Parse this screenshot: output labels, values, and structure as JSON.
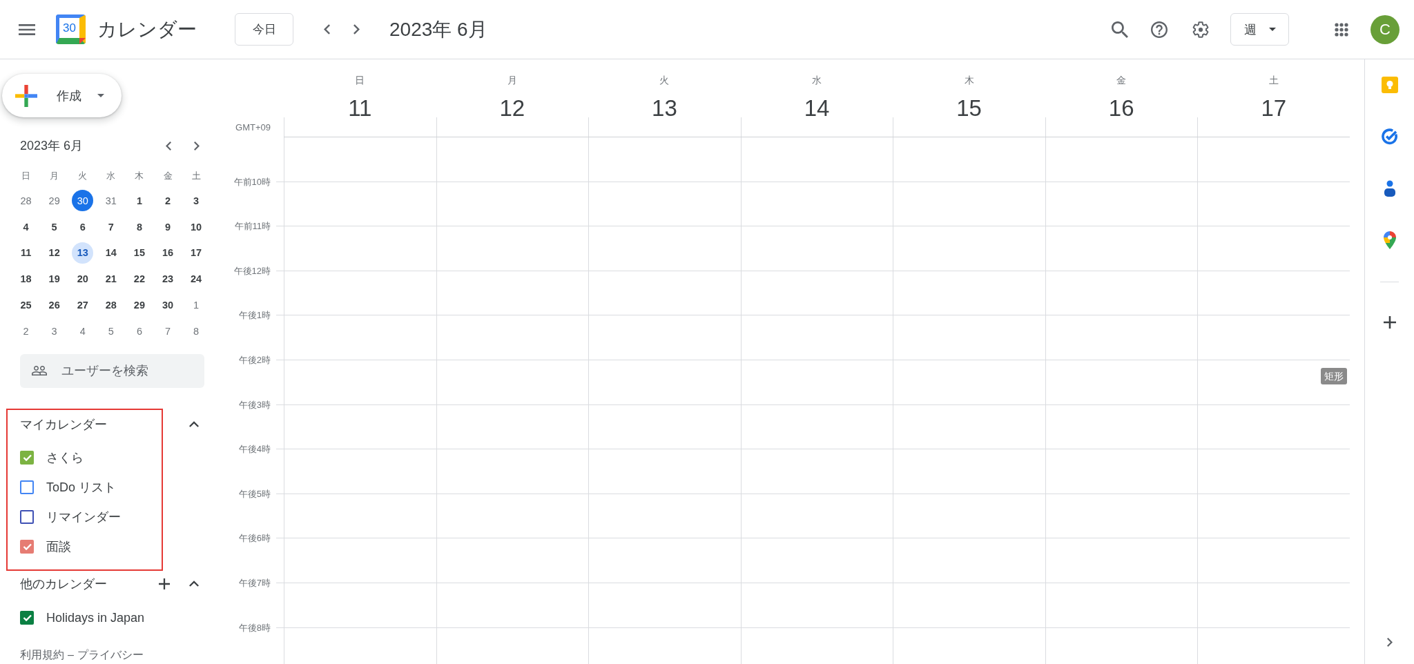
{
  "top_bar": {
    "app_name": "カレンダー",
    "logo_date": "30",
    "today_button": "今日",
    "period": "2023年 6月",
    "view_select": "週",
    "avatar_letter": "C"
  },
  "sidebar": {
    "create_button": "作成",
    "mini_calendar": {
      "title": "2023年 6月",
      "weekdays": [
        "日",
        "月",
        "火",
        "水",
        "木",
        "金",
        "土"
      ],
      "weeks": [
        [
          {
            "day": "28",
            "muted": true,
            "today": false,
            "selected": false
          },
          {
            "day": "29",
            "muted": true,
            "today": false,
            "selected": false
          },
          {
            "day": "30",
            "muted": true,
            "today": true,
            "selected": false
          },
          {
            "day": "31",
            "muted": true,
            "today": false,
            "selected": false
          },
          {
            "day": "1",
            "muted": false,
            "today": false,
            "selected": false
          },
          {
            "day": "2",
            "muted": false,
            "today": false,
            "selected": false
          },
          {
            "day": "3",
            "muted": false,
            "today": false,
            "selected": false
          }
        ],
        [
          {
            "day": "4",
            "muted": false,
            "today": false,
            "selected": false
          },
          {
            "day": "5",
            "muted": false,
            "today": false,
            "selected": false
          },
          {
            "day": "6",
            "muted": false,
            "today": false,
            "selected": false
          },
          {
            "day": "7",
            "muted": false,
            "today": false,
            "selected": false
          },
          {
            "day": "8",
            "muted": false,
            "today": false,
            "selected": false
          },
          {
            "day": "9",
            "muted": false,
            "today": false,
            "selected": false
          },
          {
            "day": "10",
            "muted": false,
            "today": false,
            "selected": false
          }
        ],
        [
          {
            "day": "11",
            "muted": false,
            "today": false,
            "selected": false
          },
          {
            "day": "12",
            "muted": false,
            "today": false,
            "selected": false
          },
          {
            "day": "13",
            "muted": false,
            "today": false,
            "selected": true
          },
          {
            "day": "14",
            "muted": false,
            "today": false,
            "selected": false
          },
          {
            "day": "15",
            "muted": false,
            "today": false,
            "selected": false
          },
          {
            "day": "16",
            "muted": false,
            "today": false,
            "selected": false
          },
          {
            "day": "17",
            "muted": false,
            "today": false,
            "selected": false
          }
        ],
        [
          {
            "day": "18",
            "muted": false,
            "today": false,
            "selected": false
          },
          {
            "day": "19",
            "muted": false,
            "today": false,
            "selected": false
          },
          {
            "day": "20",
            "muted": false,
            "today": false,
            "selected": false
          },
          {
            "day": "21",
            "muted": false,
            "today": false,
            "selected": false
          },
          {
            "day": "22",
            "muted": false,
            "today": false,
            "selected": false
          },
          {
            "day": "23",
            "muted": false,
            "today": false,
            "selected": false
          },
          {
            "day": "24",
            "muted": false,
            "today": false,
            "selected": false
          }
        ],
        [
          {
            "day": "25",
            "muted": false,
            "today": false,
            "selected": false
          },
          {
            "day": "26",
            "muted": false,
            "today": false,
            "selected": false
          },
          {
            "day": "27",
            "muted": false,
            "today": false,
            "selected": false
          },
          {
            "day": "28",
            "muted": false,
            "today": false,
            "selected": false
          },
          {
            "day": "29",
            "muted": false,
            "today": false,
            "selected": false
          },
          {
            "day": "30",
            "muted": false,
            "today": false,
            "selected": false
          },
          {
            "day": "1",
            "muted": true,
            "today": false,
            "selected": false
          }
        ],
        [
          {
            "day": "2",
            "muted": true,
            "today": false,
            "selected": false
          },
          {
            "day": "3",
            "muted": true,
            "today": false,
            "selected": false
          },
          {
            "day": "4",
            "muted": true,
            "today": false,
            "selected": false
          },
          {
            "day": "5",
            "muted": true,
            "today": false,
            "selected": false
          },
          {
            "day": "6",
            "muted": true,
            "today": false,
            "selected": false
          },
          {
            "day": "7",
            "muted": true,
            "today": false,
            "selected": false
          },
          {
            "day": "8",
            "muted": true,
            "today": false,
            "selected": false
          }
        ]
      ]
    },
    "people_search": {
      "placeholder": "ユーザーを検索"
    },
    "my_calendars": {
      "title": "マイカレンダー",
      "expanded": true,
      "highlighted": true,
      "items": [
        {
          "label": "さくら",
          "checked": true,
          "color": "#7cb342"
        },
        {
          "label": "ToDo リスト",
          "checked": false,
          "color": "#4285f4"
        },
        {
          "label": "リマインダー",
          "checked": false,
          "color": "#3f51b5"
        },
        {
          "label": "面談",
          "checked": true,
          "color": "#e67c73"
        }
      ]
    },
    "other_calendars": {
      "title": "他のカレンダー",
      "expanded": true,
      "items": [
        {
          "label": "Holidays in Japan",
          "checked": true,
          "color": "#0b8043"
        }
      ]
    },
    "footer": {
      "links": [
        "利用規約",
        "プライバシー"
      ],
      "separator": "–"
    }
  },
  "week_view": {
    "timezone": "GMT+09",
    "days": [
      {
        "weekday": "日",
        "date": "11"
      },
      {
        "weekday": "月",
        "date": "12"
      },
      {
        "weekday": "火",
        "date": "13"
      },
      {
        "weekday": "水",
        "date": "14"
      },
      {
        "weekday": "木",
        "date": "15"
      },
      {
        "weekday": "金",
        "date": "16"
      },
      {
        "weekday": "土",
        "date": "17"
      }
    ],
    "hours": [
      "午前10時",
      "午前11時",
      "午後12時",
      "午後1時",
      "午後2時",
      "午後3時",
      "午後4時",
      "午後5時",
      "午後6時",
      "午後7時",
      "午後8時"
    ],
    "overlay_tag": "矩形"
  }
}
